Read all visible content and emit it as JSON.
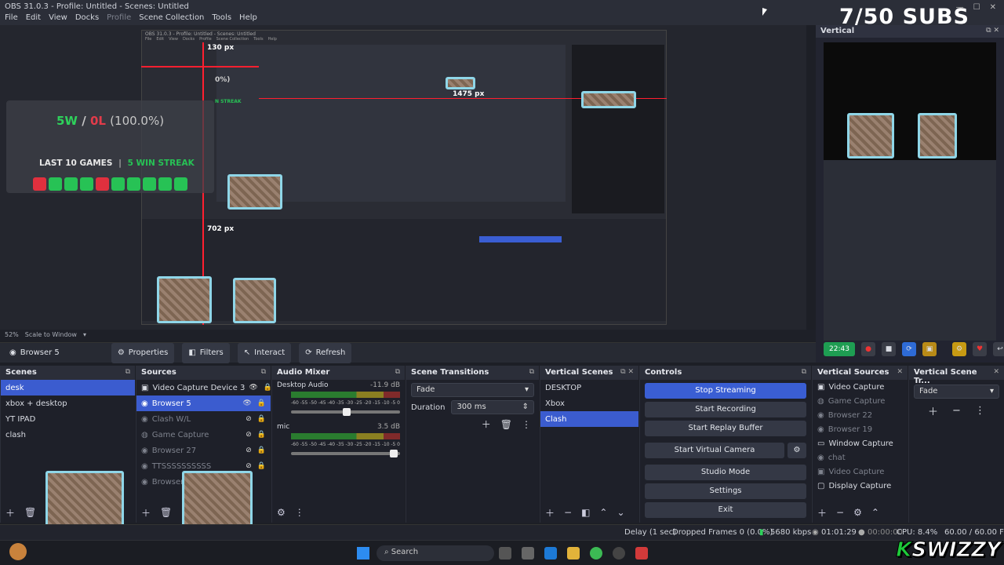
{
  "window": {
    "title": "OBS 31.0.3 - Profile: Untitled - Scenes: Untitled",
    "subs_overlay": "7/50 SUBS"
  },
  "menu": [
    "File",
    "Edit",
    "View",
    "Docks",
    "Profile",
    "Scene Collection",
    "Tools",
    "Help"
  ],
  "overlay": {
    "score_w": "5W",
    "slash": "/",
    "score_l": "0L",
    "percent": "(100.0%)",
    "last_label": "LAST 10 GAMES",
    "sep": "|",
    "streak": "5 WIN STREAK",
    "games": [
      "loss",
      "win",
      "win",
      "win",
      "loss",
      "win",
      "win",
      "win",
      "win",
      "win"
    ],
    "win_color": "#27c255",
    "loss_color": "#e0303e",
    "ruler_top": "130 px",
    "ruler_right": "1475 px",
    "ruler_bottom": "702 px",
    "ruler_left": "0%)",
    "ruler_streak": "N STREAK"
  },
  "nested": {
    "title": "OBS 31.0.3 - Profile: Untitled - Scenes: Untitled",
    "menu": [
      "File",
      "Edit",
      "View",
      "Docks",
      "Profile",
      "Scene Collection",
      "Tools",
      "Help"
    ]
  },
  "preview_status": {
    "zoom": "52%",
    "scale": "Scale to Window"
  },
  "source_bar": {
    "name": "Browser 5",
    "properties": "Properties",
    "filters": "Filters",
    "interact": "Interact",
    "refresh": "Refresh"
  },
  "vertical_panel": {
    "title": "Vertical",
    "rec_time": "22:43"
  },
  "docks": {
    "scenes": {
      "title": "Scenes",
      "items": [
        "desk",
        "xbox + desktop",
        "YT IPAD",
        "clash"
      ],
      "selected": 0
    },
    "sources": {
      "title": "Sources",
      "items": [
        "Video Capture Device 3",
        "Browser 5",
        "Clash W/L",
        "Game Capture",
        "Browser 27",
        "TTSSSSSSSSSS",
        "Browser 2"
      ],
      "selected": 1
    },
    "mixer": {
      "title": "Audio Mixer",
      "channels": [
        {
          "name": "Desktop Audio",
          "db": "-11.9 dB",
          "level": 0.55
        },
        {
          "name": "mic",
          "db": "3.5 dB",
          "level": 0.98
        }
      ],
      "scale": [
        "-60",
        "-55",
        "-50",
        "-45",
        "-40",
        "-35",
        "-30",
        "-25",
        "-20",
        "-15",
        "-10",
        "-5",
        "0"
      ]
    },
    "transitions": {
      "title": "Scene Transitions",
      "type": "Fade",
      "duration_label": "Duration",
      "duration": "300 ms"
    },
    "vscenes": {
      "title": "Vertical Scenes",
      "items": [
        "DESKTOP",
        "Xbox",
        "Clash"
      ],
      "selected": 2
    },
    "controls": {
      "title": "Controls",
      "buttons": [
        "Stop Streaming",
        "Start Recording",
        "Start Replay Buffer",
        "Start Virtual Camera",
        "Studio Mode",
        "Settings",
        "Exit"
      ]
    },
    "vsources": {
      "title": "Vertical Sources",
      "items": [
        "Video Capture",
        "Game Capture",
        "Browser 22",
        "Browser 19",
        "Window Capture",
        "chat",
        "Video Capture",
        "Display Capture"
      ]
    },
    "vtrans": {
      "title": "Vertical Scene Tr...",
      "type": "Fade"
    }
  },
  "status": {
    "delay": "Delay (1 sec)",
    "dropped": "Dropped Frames 0 (0.0%)",
    "kbps": "5680 kbps",
    "stream_time": "01:01:29",
    "rec_time": "00:00:00",
    "cpu": "CPU: 8.4%",
    "fps": "60.00 / 60.00 FPS"
  },
  "taskbar": {
    "search": "Search"
  },
  "brand": {
    "k": "K",
    "rest": "SWIZZY"
  }
}
